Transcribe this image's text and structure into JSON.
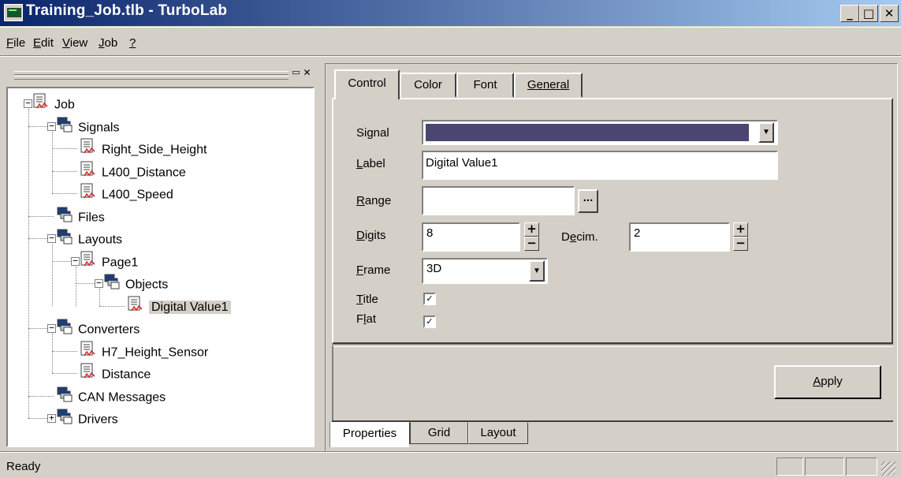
{
  "window": {
    "title": "Training_Job.tlb - TurboLab",
    "controls": {
      "minimize": "_",
      "maximize": "□",
      "close": "✕"
    }
  },
  "menu": {
    "items": [
      {
        "label": "File",
        "u": "F",
        "rest": "ile"
      },
      {
        "label": "Edit",
        "u": "E",
        "rest": "dit"
      },
      {
        "label": "View",
        "u": "V",
        "rest": "iew"
      },
      {
        "label": "Job",
        "u": "J",
        "rest": "ob"
      },
      {
        "label": "?",
        "u": "?",
        "rest": ""
      }
    ]
  },
  "tree": {
    "nodes": [
      {
        "label": "Job",
        "icon": "document-icon",
        "expander": "−"
      },
      {
        "label": "Signals",
        "icon": "folder-stack-icon",
        "expander": "−"
      },
      {
        "label": "Right_Side_Height",
        "icon": "document-icon"
      },
      {
        "label": "L400_Distance",
        "icon": "document-icon"
      },
      {
        "label": "L400_Speed",
        "icon": "document-icon"
      },
      {
        "label": "Files",
        "icon": "folder-stack-icon"
      },
      {
        "label": "Layouts",
        "icon": "folder-stack-icon",
        "expander": "−"
      },
      {
        "label": "Page1",
        "icon": "document-icon",
        "expander": "−"
      },
      {
        "label": "Objects",
        "icon": "folder-stack-icon",
        "expander": "−"
      },
      {
        "label": "Digital Value1",
        "icon": "document-icon",
        "selected": true
      },
      {
        "label": "Converters",
        "icon": "folder-stack-icon",
        "expander": "−"
      },
      {
        "label": "H7_Height_Sensor",
        "icon": "document-icon"
      },
      {
        "label": "Distance",
        "icon": "document-icon"
      },
      {
        "label": "CAN Messages",
        "icon": "folder-stack-icon"
      },
      {
        "label": "Drivers",
        "icon": "folder-stack-icon",
        "expander": "+"
      }
    ]
  },
  "tabs": {
    "top": [
      {
        "label": "Control",
        "active": true
      },
      {
        "label": "Color"
      },
      {
        "label": "Font"
      },
      {
        "label": "General"
      }
    ],
    "bottom": [
      {
        "label": "Properties",
        "active": true
      },
      {
        "label": "Grid"
      },
      {
        "label": "Layout"
      }
    ]
  },
  "form": {
    "signal": {
      "label": "Signal",
      "value": ""
    },
    "label_field": {
      "label": "Label",
      "value": "Digital Value1"
    },
    "range": {
      "label": "Range",
      "value": "",
      "browse": "..."
    },
    "digits": {
      "label": "Digits",
      "value": "8"
    },
    "decim": {
      "label": "Decim.",
      "value": "2"
    },
    "frame": {
      "label": "Frame",
      "value": "3D"
    },
    "title": {
      "label": "Title",
      "checked": true
    },
    "flat": {
      "label": "Flat",
      "checked": true
    }
  },
  "buttons": {
    "apply": "Apply"
  },
  "status": {
    "text": "Ready"
  },
  "colors": {
    "titlebar_start": "#0a246a",
    "titlebar_end": "#a6caf0",
    "face": "#d4d0c8",
    "signal_fill": "#4a4670"
  }
}
